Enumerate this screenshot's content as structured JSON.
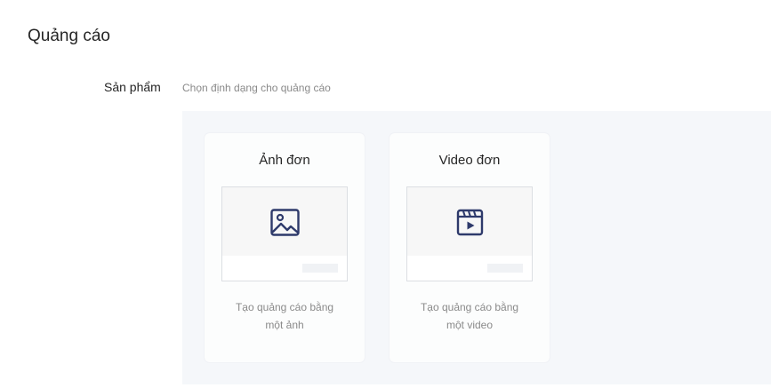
{
  "section": {
    "title": "Quảng cáo"
  },
  "product_field": {
    "label": "Sản phẩm",
    "hint": "Chọn định dạng cho quảng cáo"
  },
  "formats": [
    {
      "title": "Ảnh đơn",
      "icon": "image-icon",
      "desc_line1": "Tạo quảng cáo bằng",
      "desc_line2": "một ảnh"
    },
    {
      "title": "Video đơn",
      "icon": "video-clapper-icon",
      "desc_line1": "Tạo quảng cáo bằng",
      "desc_line2": "một video"
    }
  ],
  "colors": {
    "icon": "#2e3a6b",
    "panel_background": "#f5f7fa",
    "hint_text": "#8a8a8a"
  }
}
